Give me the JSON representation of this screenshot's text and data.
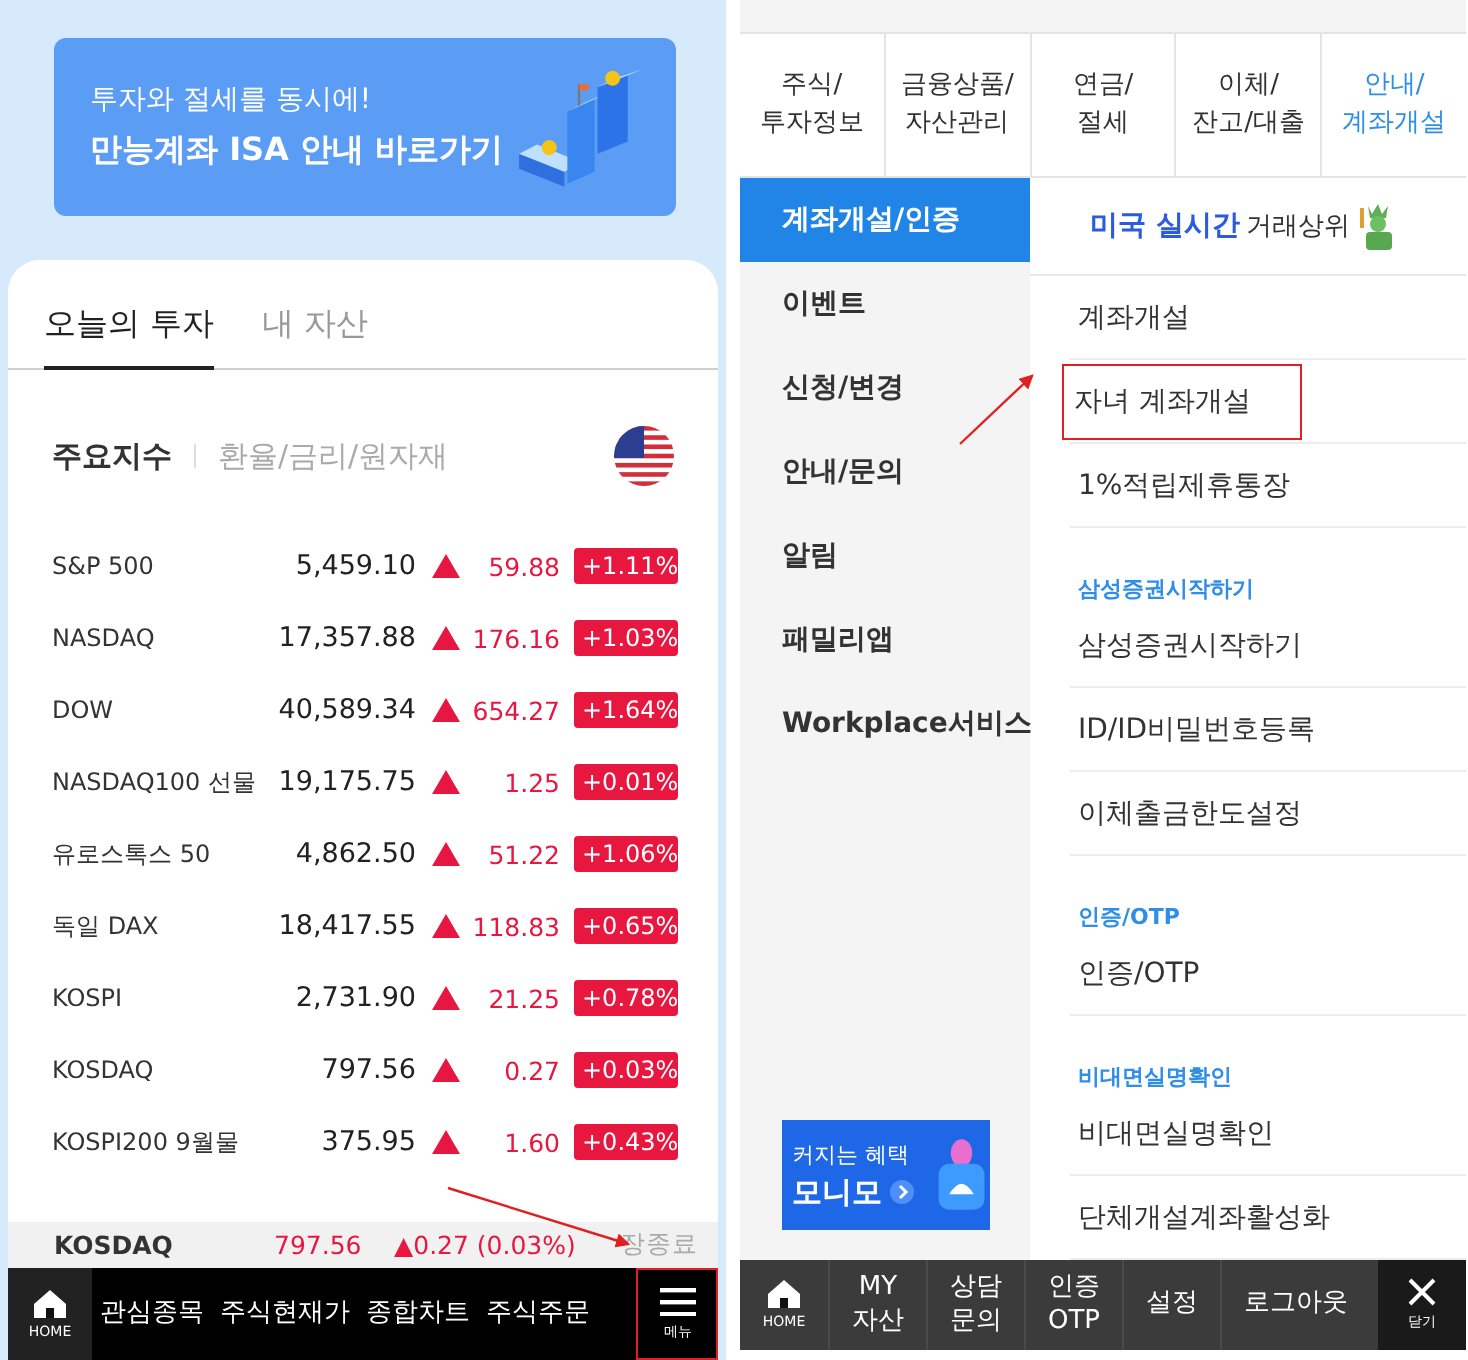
{
  "left_screen": {
    "banner": {
      "line_1": "투자와 절세를 동시에!",
      "line_2": "만능계좌 ISA 안내 바로가기",
      "kind": "picture"
    },
    "tabs": [
      {
        "label": "오늘의 투자",
        "selected": true
      },
      {
        "label": "내 자산",
        "selected": false
      }
    ],
    "section_tabs": [
      {
        "label": "주요지수",
        "selected": true
      },
      {
        "label": "환율/금리/원자재",
        "selected": false
      }
    ],
    "indices": [
      {
        "name": "S&P 500",
        "value": "5,459.10",
        "change": "59.88",
        "percent": "+1.11%"
      },
      {
        "name": "NASDAQ",
        "value": "17,357.88",
        "change": "176.16",
        "percent": "+1.03%"
      },
      {
        "name": "DOW",
        "value": "40,589.34",
        "change": "654.27",
        "percent": "+1.64%"
      },
      {
        "name": "NASDAQ100 선물",
        "value": "19,175.75",
        "change": "1.25",
        "percent": "+0.01%"
      },
      {
        "name": "유로스톡스 50",
        "value": "4,862.50",
        "change": "51.22",
        "percent": "+1.06%"
      },
      {
        "name": "독일 DAX",
        "value": "18,417.55",
        "change": "118.83",
        "percent": "+0.65%"
      },
      {
        "name": "KOSPI",
        "value": "2,731.90",
        "change": "21.25",
        "percent": "+0.78%"
      },
      {
        "name": "KOSDAQ",
        "value": "797.56",
        "change": "0.27",
        "percent": "+0.03%"
      },
      {
        "name": "KOSPI200 9월물",
        "value": "375.95",
        "change": "1.60",
        "percent": "+0.43%"
      }
    ],
    "ticker": {
      "name": "KOSDAQ",
      "value": "797.56",
      "change": "▲0.27 (0.03%)",
      "status": "장종료"
    },
    "nav": [
      {
        "kind": "home",
        "label": "HOME"
      },
      {
        "kind": "text",
        "label": "관심종목"
      },
      {
        "kind": "text",
        "label": "주식현재가"
      },
      {
        "kind": "text",
        "label": "종합차트"
      },
      {
        "kind": "text",
        "label": "주식주문"
      },
      {
        "kind": "menu",
        "label": "메뉴",
        "annotated": true
      }
    ]
  },
  "right_screen": {
    "tabs": [
      {
        "label": "주식/\n투자정보",
        "selected": false
      },
      {
        "label": "금융상품/\n자산관리",
        "selected": false
      },
      {
        "label": "연금/\n절세",
        "selected": false
      },
      {
        "label": "이체/\n잔고/대출",
        "selected": false
      },
      {
        "label": "안내/\n계좌개설",
        "selected": true
      }
    ],
    "categories": [
      {
        "label": "계좌개설/인증",
        "selected": true
      },
      {
        "label": "이벤트",
        "selected": false
      },
      {
        "label": "신청/변경",
        "selected": false
      },
      {
        "label": "안내/문의",
        "selected": false
      },
      {
        "label": "알림",
        "selected": false
      },
      {
        "label": "패밀리앱",
        "selected": false
      },
      {
        "label": "Workplace서비스",
        "selected": false
      }
    ],
    "promo": {
      "line_1": "커지는 혜택",
      "line_2": "모니모"
    },
    "top_banner": {
      "highlight": "미국 실시간",
      "text": "거래상위"
    },
    "items": [
      {
        "kind": "link",
        "label": "계좌개설",
        "annotated": false
      },
      {
        "kind": "link",
        "label": "자녀 계좌개설",
        "annotated": true
      },
      {
        "kind": "link",
        "label": "1%적립제휴통장",
        "annotated": false
      },
      {
        "kind": "heading",
        "label": "삼성증권시작하기"
      },
      {
        "kind": "link",
        "label": "삼성증권시작하기",
        "annotated": false
      },
      {
        "kind": "link",
        "label": "ID/ID비밀번호등록",
        "annotated": false
      },
      {
        "kind": "link",
        "label": "이체출금한도설정",
        "annotated": false
      },
      {
        "kind": "heading",
        "label": "인증/OTP"
      },
      {
        "kind": "link",
        "label": "인증/OTP",
        "annotated": false
      },
      {
        "kind": "heading",
        "label": "비대면실명확인"
      },
      {
        "kind": "link",
        "label": "비대면실명확인",
        "annotated": false
      },
      {
        "kind": "link",
        "label": "단체개설계좌활성화",
        "annotated": false
      }
    ],
    "nav": [
      {
        "kind": "home",
        "label": "HOME"
      },
      {
        "kind": "text",
        "label": "MY\n자산"
      },
      {
        "kind": "text",
        "label": "상담\n문의"
      },
      {
        "kind": "text",
        "label": "인증\nOTP"
      },
      {
        "kind": "text",
        "label": "설정"
      },
      {
        "kind": "text",
        "label": "로그아웃"
      },
      {
        "kind": "close",
        "label": "닫기"
      }
    ]
  }
}
